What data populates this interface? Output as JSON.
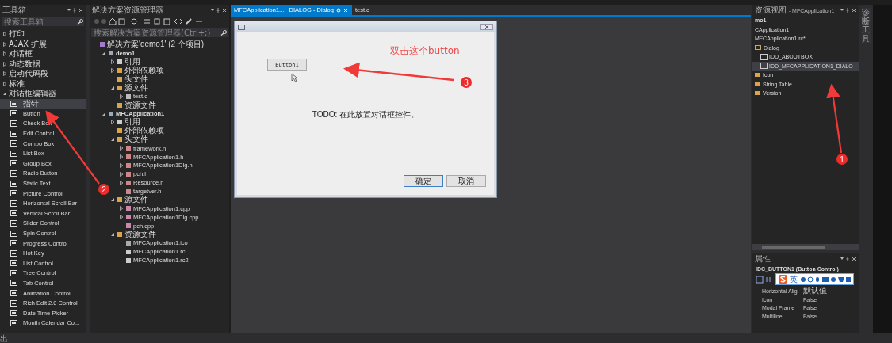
{
  "toolbox": {
    "title": "工具箱",
    "search": {
      "placeholder": "搜索工具箱"
    },
    "categories": [
      {
        "label": "打印",
        "expanded": false
      },
      {
        "label": "AJAX 扩展",
        "expanded": false
      },
      {
        "label": "对话框",
        "expanded": false
      },
      {
        "label": "动态数据",
        "expanded": false
      },
      {
        "label": "启动代码段",
        "expanded": false
      },
      {
        "label": "标准",
        "expanded": false
      },
      {
        "label": "对话框编辑器",
        "expanded": true,
        "items": [
          {
            "label": "指针",
            "selected": true
          },
          {
            "label": "Button",
            "selected": false
          },
          {
            "label": "Check Box",
            "selected": false
          },
          {
            "label": "Edit Control",
            "selected": false
          },
          {
            "label": "Combo Box",
            "selected": false
          },
          {
            "label": "List Box",
            "selected": false
          },
          {
            "label": "Group Box",
            "selected": false
          },
          {
            "label": "Radio Button",
            "selected": false
          },
          {
            "label": "Static Text",
            "selected": false
          },
          {
            "label": "Picture Control",
            "selected": false
          },
          {
            "label": "Horizontal Scroll Bar",
            "selected": false
          },
          {
            "label": "Vertical Scroll Bar",
            "selected": false
          },
          {
            "label": "Slider Control",
            "selected": false
          },
          {
            "label": "Spin Control",
            "selected": false
          },
          {
            "label": "Progress Control",
            "selected": false
          },
          {
            "label": "Hot Key",
            "selected": false
          },
          {
            "label": "List Control",
            "selected": false
          },
          {
            "label": "Tree Control",
            "selected": false
          },
          {
            "label": "Tab Control",
            "selected": false
          },
          {
            "label": "Animation Control",
            "selected": false
          },
          {
            "label": "Rich Edit 2.0 Control",
            "selected": false
          },
          {
            "label": "Date Time Picker",
            "selected": false
          },
          {
            "label": "Month Calendar Co...",
            "selected": false
          }
        ]
      }
    ]
  },
  "solution_explorer": {
    "title": "解决方案资源管理器",
    "search": {
      "placeholder": "搜索解决方案资源管理器(Ctrl+;)"
    },
    "tree": [
      {
        "label": "解决方案'demo1' (2 个项目)",
        "kind": "solution",
        "children": [
          {
            "label": "demo1",
            "kind": "project",
            "expanded": true,
            "children": [
              {
                "label": "引用",
                "kind": "reference",
                "expanded": false
              },
              {
                "label": "外部依赖项",
                "kind": "external",
                "expanded": false
              },
              {
                "label": "头文件",
                "kind": "folder"
              },
              {
                "label": "源文件",
                "kind": "folder",
                "expanded": true,
                "children": [
                  {
                    "label": "test.c",
                    "kind": "c",
                    "expanded": false
                  }
                ]
              },
              {
                "label": "资源文件",
                "kind": "folder"
              }
            ]
          },
          {
            "label": "MFCApplication1",
            "kind": "project",
            "expanded": true,
            "children": [
              {
                "label": "引用",
                "kind": "reference",
                "expanded": false
              },
              {
                "label": "外部依赖项",
                "kind": "external"
              },
              {
                "label": "头文件",
                "kind": "folder",
                "expanded": true,
                "children": [
                  {
                    "label": "framework.h",
                    "kind": "h",
                    "expanded": false
                  },
                  {
                    "label": "MFCApplication1.h",
                    "kind": "h",
                    "expanded": false
                  },
                  {
                    "label": "MFCApplication1Dlg.h",
                    "kind": "h",
                    "expanded": false
                  },
                  {
                    "label": "pch.h",
                    "kind": "h",
                    "expanded": false
                  },
                  {
                    "label": "Resource.h",
                    "kind": "h",
                    "expanded": false
                  },
                  {
                    "label": "targetver.h",
                    "kind": "h"
                  }
                ]
              },
              {
                "label": "源文件",
                "kind": "folder",
                "expanded": true,
                "children": [
                  {
                    "label": "MFCApplication1.cpp",
                    "kind": "cpp",
                    "expanded": false
                  },
                  {
                    "label": "MFCApplication1Dlg.cpp",
                    "kind": "cpp",
                    "expanded": false
                  },
                  {
                    "label": "pch.cpp",
                    "kind": "cpp"
                  }
                ]
              },
              {
                "label": "资源文件",
                "kind": "folder",
                "expanded": true,
                "children": [
                  {
                    "label": "MFCApplication1.ico",
                    "kind": "ico"
                  },
                  {
                    "label": "MFCApplication1.rc",
                    "kind": "rc"
                  },
                  {
                    "label": "MFCApplication1.rc2",
                    "kind": "rc"
                  }
                ]
              }
            ]
          }
        ]
      }
    ]
  },
  "editor": {
    "tabs": [
      {
        "label": "MFCApplication1...._DIALOG - Dialog",
        "selected": true
      },
      {
        "label": "test.c",
        "selected": false
      }
    ],
    "dialog": {
      "button": "Button1",
      "todo": "TODO: 在此放置对话框控件。",
      "ok": "确定",
      "cancel": "取消"
    }
  },
  "resource_view": {
    "title": [
      "资源视图",
      "- MFCApplication1"
    ],
    "lines": [
      "mo1",
      "CApplication1",
      "MFCApplication1.rc*"
    ],
    "folders": [
      {
        "label": "Dialog",
        "expanded": true,
        "children": [
          {
            "label": "IDD_ABOUTBOX",
            "selected": false
          },
          {
            "label": "IDD_MFCAPPLICATION1_DIALO",
            "selected": true
          }
        ]
      },
      {
        "label": "Icon",
        "expanded": false
      },
      {
        "label": "String Table",
        "expanded": false
      },
      {
        "label": "Version",
        "expanded": false
      }
    ]
  },
  "side_tab": "诊断工具",
  "properties": {
    "title": "属性",
    "object": "IDC_BUTTON1 (Button Control)",
    "rows": [
      {
        "name": "Horizontal Alig",
        "value": "默认值"
      },
      {
        "name": "Icon",
        "value": "False"
      },
      {
        "name": "Modal Frame",
        "value": "False"
      },
      {
        "name": "Multiline",
        "value": "False"
      }
    ]
  },
  "ime_bar": {
    "mode": "英"
  },
  "bottom_tab": "出",
  "annotations": [
    {
      "number": "1"
    },
    {
      "number": "2"
    },
    {
      "number": "3",
      "note": "双击这个button"
    }
  ]
}
